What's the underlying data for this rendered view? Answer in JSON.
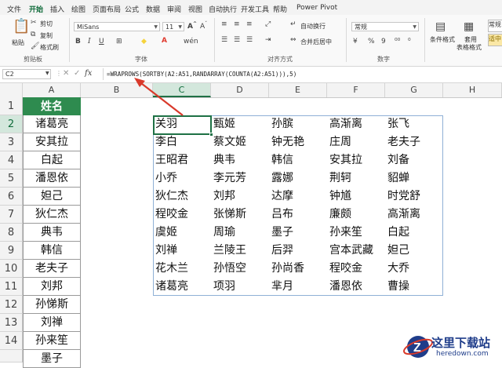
{
  "tabs": [
    "文件",
    "开始",
    "插入",
    "绘图",
    "页面布局",
    "公式",
    "数据",
    "审阅",
    "视图",
    "自动执行",
    "开发工具",
    "帮助",
    "Power Pivot"
  ],
  "ribbon": {
    "paste": "粘贴",
    "cut": "剪切",
    "copy": "复制",
    "format_painter": "格式刷",
    "clipboard_group": "剪贴板",
    "font_name": "MiSans",
    "font_size": "11",
    "font_group": "字体",
    "wrap_text": "自动换行",
    "merge_center": "合并后居中",
    "align_group": "对齐方式",
    "number_format": "常规",
    "number_group": "数字",
    "percent": "%",
    "comma": "9",
    "cond_format": "条件格式",
    "table_format_1": "套用",
    "table_format_2": "表格格式",
    "style_normal": "常规",
    "style_bad": "适中",
    "font_color": "#e03b2f",
    "fill_color": "#f5d33c",
    "accent": "#1e7145"
  },
  "formula_bar": {
    "name_box": "C2",
    "fx": "fx",
    "formula": "=WRAPROWS(SORTBY(A2:A51,RANDARRAY(COUNTA(A2:A51))),5)"
  },
  "columns": [
    "A",
    "B",
    "C",
    "D",
    "E",
    "F",
    "G",
    "H"
  ],
  "rows": [
    "1",
    "2",
    "3",
    "4",
    "5",
    "6",
    "7",
    "8",
    "9",
    "10",
    "11",
    "12",
    "13",
    "14"
  ],
  "column_a": [
    "姓名",
    "诸葛亮",
    "安其拉",
    "白起",
    "潘恩依",
    "妲己",
    "狄仁杰",
    "典韦",
    "韩信",
    "老夫子",
    "刘邦",
    "孙悌斯",
    "刘禅",
    "孙来笙",
    "墨子"
  ],
  "grid": [
    [
      "关羽",
      "甄姬",
      "孙膑",
      "高渐离",
      "张飞"
    ],
    [
      "李白",
      "蔡文姬",
      "钟无艳",
      "庄周",
      "老夫子"
    ],
    [
      "王昭君",
      "典韦",
      "韩信",
      "安其拉",
      "刘备"
    ],
    [
      "小乔",
      "李元芳",
      "露娜",
      "荆轲",
      "貂蝉"
    ],
    [
      "狄仁杰",
      "刘邦",
      "达摩",
      "钟馗",
      "时党舒"
    ],
    [
      "程咬金",
      "张悌斯",
      "吕布",
      "廉颇",
      "高渐离"
    ],
    [
      "虞姬",
      "周瑜",
      "墨子",
      "孙来笙",
      "白起"
    ],
    [
      "刘禅",
      "兰陵王",
      "后羿",
      "宫本武藏",
      "妲己"
    ],
    [
      "花木兰",
      "孙悟空",
      "孙尚香",
      "程咬金",
      "大乔"
    ],
    [
      "诸葛亮",
      "项羽",
      "芈月",
      "潘恩依",
      "曹操"
    ]
  ],
  "watermark": {
    "site_name": "这里下载站",
    "url": "heredown.com"
  }
}
